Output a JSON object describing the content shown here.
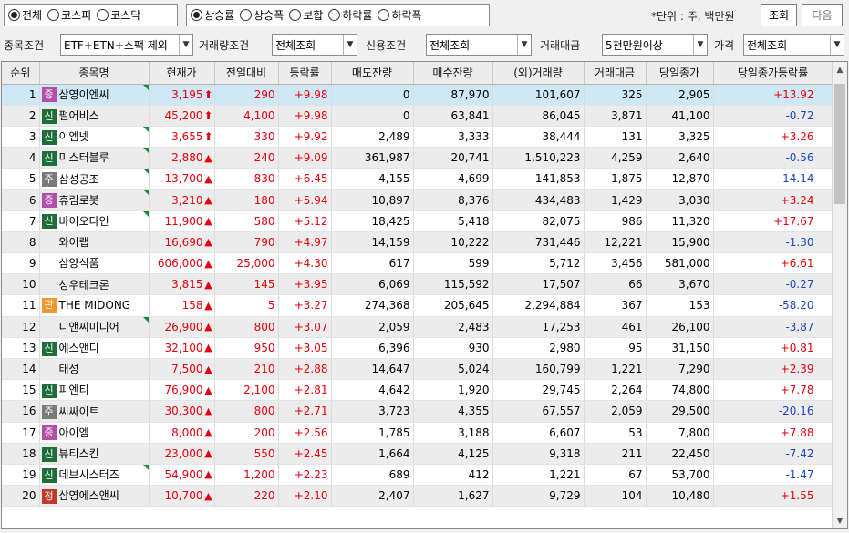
{
  "toolbar": {
    "market_options": [
      {
        "label": "전체",
        "checked": true
      },
      {
        "label": "코스피",
        "checked": false
      },
      {
        "label": "코스닥",
        "checked": false
      }
    ],
    "sort_options": [
      {
        "label": "상승률",
        "checked": true
      },
      {
        "label": "상승폭",
        "checked": false
      },
      {
        "label": "보합",
        "checked": false
      },
      {
        "label": "하락률",
        "checked": false
      },
      {
        "label": "하락폭",
        "checked": false
      }
    ],
    "unit_text": "*단위 : 주, 백만원",
    "search_label": "조회",
    "next_label": "다음"
  },
  "filters": {
    "stock_condition_label": "종목조건",
    "stock_condition_value": "ETF+ETN+스팩 제외",
    "volume_condition_label": "거래량조건",
    "volume_condition_value": "전체조회",
    "credit_condition_label": "신용조건",
    "credit_condition_value": "전체조회",
    "trade_amount_label": "거래대금",
    "trade_amount_value": "5천만원이상",
    "price_label": "가격",
    "price_value": "전체조회"
  },
  "columns": [
    "순위",
    "종목명",
    "현재가",
    "전일대비",
    "등락률",
    "매도잔량",
    "매수잔량",
    "(외)거래량",
    "거래대금",
    "당일종가",
    "당일종가등락률"
  ],
  "badge_colors": {
    "증": "#b24fa8",
    "신": "#1f6e3a",
    "주": "#7a7a7a",
    "관": "#f0962a",
    "정": "#c0392b"
  },
  "rows": [
    {
      "rank": "1",
      "badge": "증",
      "name": "삼영이엔씨",
      "flag": true,
      "price": "3,195",
      "mark": "up-arrow",
      "change": "290",
      "rate": "+9.98",
      "sell": "0",
      "buy": "87,970",
      "volume": "101,607",
      "amount": "325",
      "close": "2,905",
      "close_rate": "+13.92",
      "close_dir": "up"
    },
    {
      "rank": "2",
      "badge": "신",
      "name": "펄어비스",
      "flag": false,
      "price": "45,200",
      "mark": "up-arrow",
      "change": "4,100",
      "rate": "+9.98",
      "sell": "0",
      "buy": "63,841",
      "volume": "86,045",
      "amount": "3,871",
      "close": "41,100",
      "close_rate": "-0.72",
      "close_dir": "down"
    },
    {
      "rank": "3",
      "badge": "신",
      "name": "이엠넷",
      "flag": true,
      "price": "3,655",
      "mark": "up-arrow",
      "change": "330",
      "rate": "+9.92",
      "sell": "2,489",
      "buy": "3,333",
      "volume": "38,444",
      "amount": "131",
      "close": "3,325",
      "close_rate": "+3.26",
      "close_dir": "up"
    },
    {
      "rank": "4",
      "badge": "신",
      "name": "미스터블루",
      "flag": true,
      "price": "2,880",
      "mark": "up",
      "change": "240",
      "rate": "+9.09",
      "sell": "361,987",
      "buy": "20,741",
      "volume": "1,510,223",
      "amount": "4,259",
      "close": "2,640",
      "close_rate": "-0.56",
      "close_dir": "down"
    },
    {
      "rank": "5",
      "badge": "주",
      "name": "삼성공조",
      "flag": true,
      "price": "13,700",
      "mark": "up",
      "change": "830",
      "rate": "+6.45",
      "sell": "4,155",
      "buy": "4,699",
      "volume": "141,853",
      "amount": "1,875",
      "close": "12,870",
      "close_rate": "-14.14",
      "close_dir": "down"
    },
    {
      "rank": "6",
      "badge": "증",
      "name": "휴림로봇",
      "flag": true,
      "price": "3,210",
      "mark": "up",
      "change": "180",
      "rate": "+5.94",
      "sell": "10,897",
      "buy": "8,376",
      "volume": "434,483",
      "amount": "1,429",
      "close": "3,030",
      "close_rate": "+3.24",
      "close_dir": "up"
    },
    {
      "rank": "7",
      "badge": "신",
      "name": "바이오다인",
      "flag": true,
      "price": "11,900",
      "mark": "up",
      "change": "580",
      "rate": "+5.12",
      "sell": "18,425",
      "buy": "5,418",
      "volume": "82,075",
      "amount": "986",
      "close": "11,320",
      "close_rate": "+17.67",
      "close_dir": "up"
    },
    {
      "rank": "8",
      "badge": "",
      "name": "와이랩",
      "flag": false,
      "price": "16,690",
      "mark": "up",
      "change": "790",
      "rate": "+4.97",
      "sell": "14,159",
      "buy": "10,222",
      "volume": "731,446",
      "amount": "12,221",
      "close": "15,900",
      "close_rate": "-1.30",
      "close_dir": "down"
    },
    {
      "rank": "9",
      "badge": "",
      "name": "삼양식품",
      "flag": false,
      "price": "606,000",
      "mark": "up",
      "change": "25,000",
      "rate": "+4.30",
      "sell": "617",
      "buy": "599",
      "volume": "5,712",
      "amount": "3,456",
      "close": "581,000",
      "close_rate": "+6.61",
      "close_dir": "up"
    },
    {
      "rank": "10",
      "badge": "",
      "name": "성우테크론",
      "flag": false,
      "price": "3,815",
      "mark": "up",
      "change": "145",
      "rate": "+3.95",
      "sell": "6,069",
      "buy": "115,592",
      "volume": "17,507",
      "amount": "66",
      "close": "3,670",
      "close_rate": "-0.27",
      "close_dir": "down"
    },
    {
      "rank": "11",
      "badge": "관",
      "name": "THE MIDONG",
      "flag": false,
      "price": "158",
      "mark": "up",
      "change": "5",
      "rate": "+3.27",
      "sell": "274,368",
      "buy": "205,645",
      "volume": "2,294,884",
      "amount": "367",
      "close": "153",
      "close_rate": "-58.20",
      "close_dir": "down"
    },
    {
      "rank": "12",
      "badge": "",
      "name": "디앤씨미디어",
      "flag": true,
      "price": "26,900",
      "mark": "up",
      "change": "800",
      "rate": "+3.07",
      "sell": "2,059",
      "buy": "2,483",
      "volume": "17,253",
      "amount": "461",
      "close": "26,100",
      "close_rate": "-3.87",
      "close_dir": "down"
    },
    {
      "rank": "13",
      "badge": "신",
      "name": "에스앤디",
      "flag": false,
      "price": "32,100",
      "mark": "up",
      "change": "950",
      "rate": "+3.05",
      "sell": "6,396",
      "buy": "930",
      "volume": "2,980",
      "amount": "95",
      "close": "31,150",
      "close_rate": "+0.81",
      "close_dir": "up"
    },
    {
      "rank": "14",
      "badge": "",
      "name": "태성",
      "flag": false,
      "price": "7,500",
      "mark": "up",
      "change": "210",
      "rate": "+2.88",
      "sell": "14,647",
      "buy": "5,024",
      "volume": "160,799",
      "amount": "1,221",
      "close": "7,290",
      "close_rate": "+2.39",
      "close_dir": "up"
    },
    {
      "rank": "15",
      "badge": "신",
      "name": "피엔티",
      "flag": false,
      "price": "76,900",
      "mark": "up",
      "change": "2,100",
      "rate": "+2.81",
      "sell": "4,642",
      "buy": "1,920",
      "volume": "29,745",
      "amount": "2,264",
      "close": "74,800",
      "close_rate": "+7.78",
      "close_dir": "up"
    },
    {
      "rank": "16",
      "badge": "주",
      "name": "씨싸이트",
      "flag": false,
      "price": "30,300",
      "mark": "up",
      "change": "800",
      "rate": "+2.71",
      "sell": "3,723",
      "buy": "4,355",
      "volume": "67,557",
      "amount": "2,059",
      "close": "29,500",
      "close_rate": "-20.16",
      "close_dir": "down"
    },
    {
      "rank": "17",
      "badge": "증",
      "name": "아이엠",
      "flag": false,
      "price": "8,000",
      "mark": "up",
      "change": "200",
      "rate": "+2.56",
      "sell": "1,785",
      "buy": "3,188",
      "volume": "6,607",
      "amount": "53",
      "close": "7,800",
      "close_rate": "+7.88",
      "close_dir": "up"
    },
    {
      "rank": "18",
      "badge": "신",
      "name": "뷰티스킨",
      "flag": false,
      "price": "23,000",
      "mark": "up",
      "change": "550",
      "rate": "+2.45",
      "sell": "1,664",
      "buy": "4,125",
      "volume": "9,318",
      "amount": "211",
      "close": "22,450",
      "close_rate": "-7.42",
      "close_dir": "down"
    },
    {
      "rank": "19",
      "badge": "신",
      "name": "데브시스터즈",
      "flag": true,
      "price": "54,900",
      "mark": "up",
      "change": "1,200",
      "rate": "+2.23",
      "sell": "689",
      "buy": "412",
      "volume": "1,221",
      "amount": "67",
      "close": "53,700",
      "close_rate": "-1.47",
      "close_dir": "down"
    },
    {
      "rank": "20",
      "badge": "정",
      "name": "삼영에스앤씨",
      "flag": false,
      "price": "10,700",
      "mark": "up",
      "change": "220",
      "rate": "+2.10",
      "sell": "2,407",
      "buy": "1,627",
      "volume": "9,729",
      "amount": "104",
      "close": "10,480",
      "close_rate": "+1.55",
      "close_dir": "up"
    }
  ],
  "selected_row": 0,
  "colors": {
    "up": "#e8000b",
    "down": "#1a45c8",
    "selected": "#cfe8f6"
  }
}
